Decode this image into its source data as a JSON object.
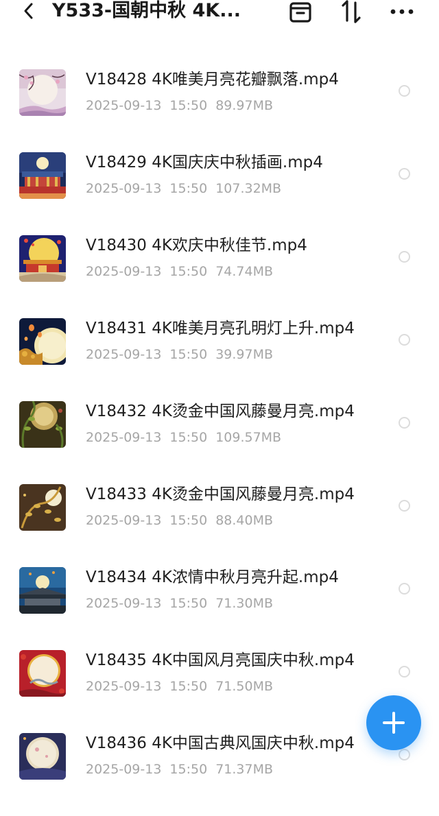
{
  "header": {
    "title": "Y533-国朝中秋 4K...",
    "back_icon": "chevron-left-icon",
    "icons": [
      "archive-box-icon",
      "sort-arrows-icon",
      "more-dots-icon"
    ]
  },
  "files": [
    {
      "name": "V18428 4K唯美月亮花瓣飘落.mp4",
      "date": "2025-09-13",
      "time": "15:50",
      "size": "89.97MB",
      "thumb": "moon-petals"
    },
    {
      "name": "V18429 4K国庆庆中秋插画.mp4",
      "date": "2025-09-13",
      "time": "15:50",
      "size": "107.32MB",
      "thumb": "palace-night"
    },
    {
      "name": "V18430 4K欢庆中秋佳节.mp4",
      "date": "2025-09-13",
      "time": "15:50",
      "size": "74.74MB",
      "thumb": "palace-moon"
    },
    {
      "name": "V18431 4K唯美月亮孔明灯上升.mp4",
      "date": "2025-09-13",
      "time": "15:50",
      "size": "39.97MB",
      "thumb": "lantern-moon"
    },
    {
      "name": "V18432 4K烫金中国风藤曼月亮.mp4",
      "date": "2025-09-13",
      "time": "15:50",
      "size": "109.57MB",
      "thumb": "vine-moon"
    },
    {
      "name": "V18433 4K烫金中国风藤曼月亮.mp4",
      "date": "2025-09-13",
      "time": "15:50",
      "size": "88.40MB",
      "thumb": "vine-moon-2"
    },
    {
      "name": "V18434 4K浓情中秋月亮升起.mp4",
      "date": "2025-09-13",
      "time": "15:50",
      "size": "71.30MB",
      "thumb": "rooftop-moon"
    },
    {
      "name": "V18435 4K中国风月亮国庆中秋.mp4",
      "date": "2025-09-13",
      "time": "15:50",
      "size": "71.50MB",
      "thumb": "red-frame-moon"
    },
    {
      "name": "V18436 4K中国古典风国庆中秋.mp4",
      "date": "2025-09-13",
      "time": "15:50",
      "size": "71.37MB",
      "thumb": "classic-moon"
    }
  ],
  "fab": {
    "icon": "plus-icon"
  },
  "colors": {
    "accent": "#2a93f2",
    "text": "#1f1f1f",
    "meta": "#a6a6a6"
  }
}
